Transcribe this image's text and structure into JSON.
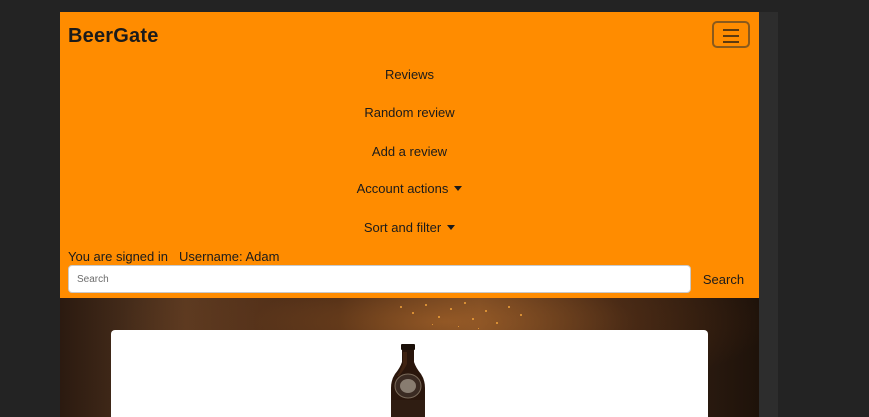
{
  "navbar": {
    "brand": "BeerGate",
    "links": [
      {
        "label": "Reviews"
      },
      {
        "label": "Random review"
      },
      {
        "label": "Add a review"
      },
      {
        "label": "Account actions"
      },
      {
        "label": "Sort and filter"
      }
    ],
    "status": {
      "signed_in": "You are signed in",
      "username": "Username: Adam"
    },
    "search": {
      "placeholder": "Search",
      "button_label": "Search"
    }
  },
  "colors": {
    "navbar_bg": "#ff8c00",
    "page_bg": "#232323"
  }
}
